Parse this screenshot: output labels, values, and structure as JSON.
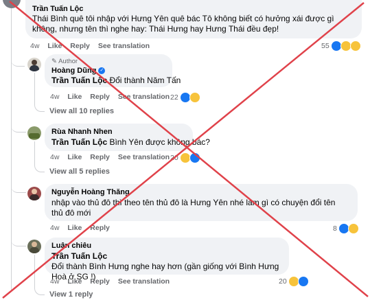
{
  "comments": [
    {
      "author": "Trần Tuấn Lộc",
      "text": "Thái Bình quê tôi nhập với Hưng Yên quê bác Tô không biết có hưởng xái được gì không, nhưng tên thì nghe hay: Thái Hưng hay Hưng Thái đều đẹp!",
      "time": "4w",
      "like": "Like",
      "reply": "Reply",
      "translate": "See translation",
      "reactions": "55"
    },
    {
      "badge": "Author",
      "author": "Hoàng Dũng",
      "mention": "Trần Tuấn Lộc",
      "text": "Đổi thành Năm Tấn",
      "time": "4w",
      "like": "Like",
      "reply": "Reply",
      "translate": "See translation",
      "reactions": "22",
      "view_replies": "View all 10 replies"
    },
    {
      "author": "Rùa Nhanh Nhen",
      "mention": "Trần Tuấn Lộc",
      "text": "Bình Yên được không bác?",
      "time": "4w",
      "like": "Like",
      "reply": "Reply",
      "translate": "See translation",
      "reactions": "20",
      "view_replies": "View all 5 replies"
    },
    {
      "author": "Nguyễn Hoàng Thăng",
      "text": "nhập vào thủ đô thì theo tên thủ đô là Hưng Yên nhé làm gì có chuyện đổi tên thủ đô mới",
      "time": "4w",
      "like": "Like",
      "reply": "Reply",
      "reactions": "8"
    },
    {
      "author": "Luân chiêu",
      "mention": "Trần Tuấn Lộc",
      "text": "Đổi thành Bình Hưng nghe hay hơn (gần giống với Bình Hưng Hoà ở SG !)",
      "time": "4w",
      "like": "Like",
      "reply": "Reply",
      "translate": "See translation",
      "reactions": "20",
      "view_replies": "View 1 reply"
    }
  ],
  "colors": {
    "bubble": "#f0f2f5",
    "meta": "#65676b",
    "like_blue": "#1877f2",
    "cross_red": "#e0424a"
  }
}
